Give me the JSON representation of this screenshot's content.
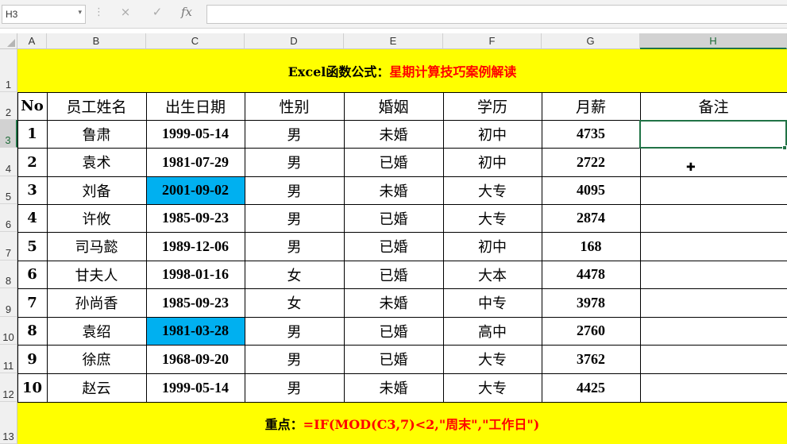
{
  "formula_bar": {
    "name_box": "H3",
    "name_box_arrow": "▾",
    "cancel_icon": "×",
    "confirm_icon": "✓",
    "fx_label": "fx",
    "formula": ""
  },
  "columns": [
    "A",
    "B",
    "C",
    "D",
    "E",
    "F",
    "G",
    "H"
  ],
  "rows": [
    "1",
    "2",
    "3",
    "4",
    "5",
    "6",
    "7",
    "8",
    "9",
    "10",
    "11",
    "12",
    "13"
  ],
  "title": {
    "prefix": "Excel函数公式：",
    "main": "星期计算技巧案例解读"
  },
  "headers": [
    "No",
    "员工姓名",
    "出生日期",
    "性别",
    "婚姻",
    "学历",
    "月薪",
    "备注"
  ],
  "records": [
    {
      "no": "1",
      "name": "鲁肃",
      "birth": "1999-05-14",
      "gender": "男",
      "marital": "未婚",
      "edu": "初中",
      "salary": "4735",
      "note": ""
    },
    {
      "no": "2",
      "name": "袁术",
      "birth": "1981-07-29",
      "gender": "男",
      "marital": "已婚",
      "edu": "初中",
      "salary": "2722",
      "note": ""
    },
    {
      "no": "3",
      "name": "刘备",
      "birth": "2001-09-02",
      "gender": "男",
      "marital": "未婚",
      "edu": "大专",
      "salary": "4095",
      "note": ""
    },
    {
      "no": "4",
      "name": "许攸",
      "birth": "1985-09-23",
      "gender": "男",
      "marital": "已婚",
      "edu": "大专",
      "salary": "2874",
      "note": ""
    },
    {
      "no": "5",
      "name": "司马懿",
      "birth": "1989-12-06",
      "gender": "男",
      "marital": "已婚",
      "edu": "初中",
      "salary": "168",
      "note": ""
    },
    {
      "no": "6",
      "name": "甘夫人",
      "birth": "1998-01-16",
      "gender": "女",
      "marital": "已婚",
      "edu": "大本",
      "salary": "4478",
      "note": ""
    },
    {
      "no": "7",
      "name": "孙尚香",
      "birth": "1985-09-23",
      "gender": "女",
      "marital": "未婚",
      "edu": "中专",
      "salary": "3978",
      "note": ""
    },
    {
      "no": "8",
      "name": "袁绍",
      "birth": "1981-03-28",
      "gender": "男",
      "marital": "已婚",
      "edu": "高中",
      "salary": "2760",
      "note": ""
    },
    {
      "no": "9",
      "name": "徐庶",
      "birth": "1968-09-20",
      "gender": "男",
      "marital": "已婚",
      "edu": "大专",
      "salary": "3762",
      "note": ""
    },
    {
      "no": "10",
      "name": "赵云",
      "birth": "1999-05-14",
      "gender": "男",
      "marital": "未婚",
      "edu": "大专",
      "salary": "4425",
      "note": ""
    }
  ],
  "footer": {
    "prefix": "重点：",
    "formula": "=IF(MOD(C3,7)<2,\"周末\",\"工作日\")"
  },
  "colors": {
    "banner": "#ffff00",
    "highlight": "#00b0f0",
    "accent": "#ff0000",
    "selection": "#217346"
  },
  "highlighted_rows": [
    2,
    7
  ],
  "selected_cell": "H3",
  "cursor_icon": "plus-cursor-icon"
}
